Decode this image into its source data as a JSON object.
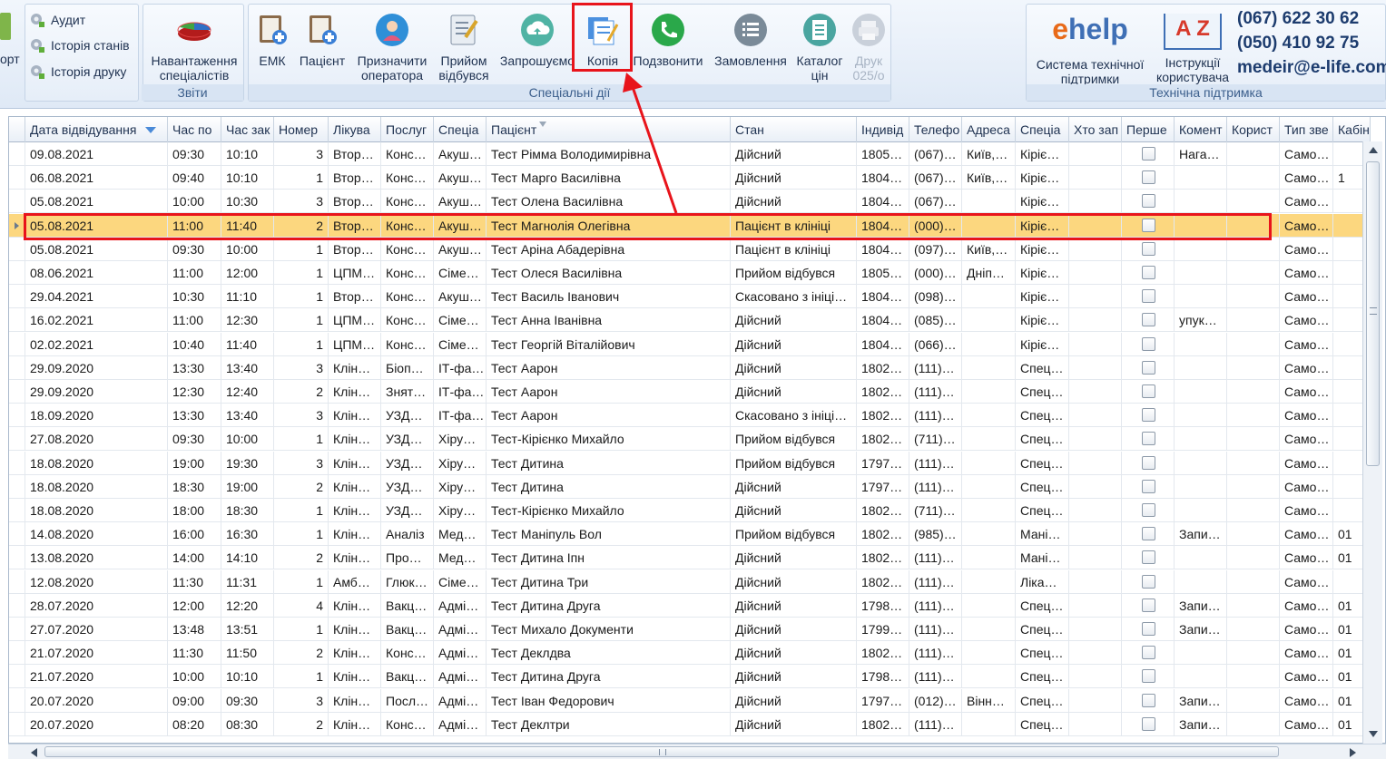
{
  "ribbon": {
    "left_partial_label": "орт",
    "reports_group": {
      "label": "Звіти",
      "items": [
        "Аудит",
        "Історія станів",
        "Історія друку"
      ],
      "workload": "Навантаження\nспеціалістів"
    },
    "special_group": {
      "label": "Спеціальні дії",
      "buttons": [
        {
          "label": "ЕМК"
        },
        {
          "label": "Пацієнт"
        },
        {
          "label": "Призначити\nоператора"
        },
        {
          "label": "Прийом\nвідбувся"
        },
        {
          "label": "Запрошуємо"
        },
        {
          "label": "Копія"
        },
        {
          "label": "Подзвонити"
        },
        {
          "label": "Замовлення"
        },
        {
          "label": "Каталог\nцін"
        },
        {
          "label": "Друк\n025/о"
        }
      ]
    },
    "support_group": {
      "label": "Технічна підтримка",
      "help_logo": "help",
      "help_label": "Система технічної\nпідтримки",
      "manual_label": "Інструкції\nкористувача",
      "az": "A Z",
      "phone1": "(067) 622 30 62",
      "phone2": "(050) 410 92 75",
      "email": "medeir@e-life.com"
    }
  },
  "grid": {
    "columns": [
      "Дата відвідування",
      "Час по",
      "Час зак",
      "Номер",
      "Лікува",
      "Послуг",
      "Спеціа",
      "Пацієнт",
      "Стан",
      "Індивід",
      "Телефо",
      "Адреса",
      "Спеціа",
      "Хто зап",
      "Перше",
      "Комент",
      "Корист",
      "Тип зве",
      "Кабін"
    ],
    "rows": [
      [
        "09.08.2021",
        "09:30",
        "10:10",
        "3",
        "Втор…",
        "Конс…",
        "Акуш…",
        "Тест Рімма Володимирівна",
        "Дійсний",
        "1805…",
        "(067)…",
        "Київ,…",
        "Кіріє…",
        "",
        "",
        "Нага…",
        "",
        "Само…",
        ""
      ],
      [
        "06.08.2021",
        "09:40",
        "10:10",
        "1",
        "Втор…",
        "Конс…",
        "Акуш…",
        "Тест Марго Василівна",
        "Дійсний",
        "1804…",
        "(067)…",
        "Київ,…",
        "Кіріє…",
        "",
        "",
        "",
        "",
        "Само…",
        "1"
      ],
      [
        "05.08.2021",
        "10:00",
        "10:30",
        "3",
        "Втор…",
        "Конс…",
        "Акуш…",
        "Тест Олена Василівна",
        "Дійсний",
        "1804…",
        "(067)…",
        "",
        "Кіріє…",
        "",
        "",
        "",
        "",
        "Само…",
        ""
      ],
      [
        "05.08.2021",
        "11:00",
        "11:40",
        "2",
        "Втор…",
        "Конс…",
        "Акуш…",
        "Тест Магнолія Олегівна",
        "Пацієнт в клініці",
        "1804…",
        "(000)…",
        "",
        "Кіріє…",
        "",
        "",
        "",
        "",
        "Само…",
        ""
      ],
      [
        "05.08.2021",
        "09:30",
        "10:00",
        "1",
        "Втор…",
        "Конс…",
        "Акуш…",
        "Тест Аріна Абадерівна",
        "Пацієнт в клініці",
        "1804…",
        "(097)…",
        "Київ,…",
        "Кіріє…",
        "",
        "",
        "",
        "",
        "Само…",
        ""
      ],
      [
        "08.06.2021",
        "11:00",
        "12:00",
        "1",
        "ЦПМ…",
        "Конс…",
        "Сіме…",
        "Тест Олеся Василівна",
        "Прийом відбувся",
        "1805…",
        "(000)…",
        "Дніп…",
        "Кіріє…",
        "",
        "",
        "",
        "",
        "Само…",
        ""
      ],
      [
        "29.04.2021",
        "10:30",
        "11:10",
        "1",
        "Втор…",
        "Конс…",
        "Акуш…",
        "Тест Василь Іванович",
        "Скасовано з ініці…",
        "1804…",
        "(098)…",
        "",
        "Кіріє…",
        "",
        "",
        "",
        "",
        "Само…",
        ""
      ],
      [
        "16.02.2021",
        "11:00",
        "12:30",
        "1",
        "ЦПМ…",
        "Конс…",
        "Сіме…",
        "Тест Анна Іванівна",
        "Дійсний",
        "1804…",
        "(085)…",
        "",
        "Кіріє…",
        "",
        "",
        "упук…",
        "",
        "Само…",
        ""
      ],
      [
        "02.02.2021",
        "10:40",
        "11:40",
        "1",
        "ЦПМ…",
        "Конс…",
        "Сіме…",
        "Тест Георгій Віталійович",
        "Дійсний",
        "1804…",
        "(066)…",
        "",
        "Кіріє…",
        "",
        "",
        "",
        "",
        "Само…",
        ""
      ],
      [
        "29.09.2020",
        "13:30",
        "13:40",
        "3",
        "Клін…",
        "Біоп…",
        "ІТ-фа…",
        "Тест Аарон",
        "Дійсний",
        "1802…",
        "(111)…",
        "",
        "Спец…",
        "",
        "",
        "",
        "",
        "Само…",
        ""
      ],
      [
        "29.09.2020",
        "12:30",
        "12:40",
        "2",
        "Клін…",
        "Знят…",
        "ІТ-фа…",
        "Тест Аарон",
        "Дійсний",
        "1802…",
        "(111)…",
        "",
        "Спец…",
        "",
        "",
        "",
        "",
        "Само…",
        ""
      ],
      [
        "18.09.2020",
        "13:30",
        "13:40",
        "3",
        "Клін…",
        "УЗД…",
        "ІТ-фа…",
        "Тест Аарон",
        "Скасовано з ініці…",
        "1802…",
        "(111)…",
        "",
        "Спец…",
        "",
        "",
        "",
        "",
        "Само…",
        ""
      ],
      [
        "27.08.2020",
        "09:30",
        "10:00",
        "1",
        "Клін…",
        "УЗД…",
        "Хіру…",
        "Тест-Кірієнко Михайло",
        "Прийом відбувся",
        "1802…",
        "(711)…",
        "",
        "Спец…",
        "",
        "",
        "",
        "",
        "Само…",
        ""
      ],
      [
        "18.08.2020",
        "19:00",
        "19:30",
        "3",
        "Клін…",
        "УЗД…",
        "Хіру…",
        "Тест Дитина",
        "Прийом відбувся",
        "1797…",
        "(111)…",
        "",
        "Спец…",
        "",
        "",
        "",
        "",
        "Само…",
        ""
      ],
      [
        "18.08.2020",
        "18:30",
        "19:00",
        "2",
        "Клін…",
        "УЗД…",
        "Хіру…",
        "Тест Дитина",
        "Дійсний",
        "1797…",
        "(111)…",
        "",
        "Спец…",
        "",
        "",
        "",
        "",
        "Само…",
        ""
      ],
      [
        "18.08.2020",
        "18:00",
        "18:30",
        "1",
        "Клін…",
        "УЗД…",
        "Хіру…",
        "Тест-Кірієнко Михайло",
        "Дійсний",
        "1802…",
        "(711)…",
        "",
        "Спец…",
        "",
        "",
        "",
        "",
        "Само…",
        ""
      ],
      [
        "14.08.2020",
        "16:00",
        "16:30",
        "1",
        "Клін…",
        "Аналіз",
        "Мед…",
        "Тест Маніпуль Вол",
        "Прийом відбувся",
        "1802…",
        "(985)…",
        "",
        "Мані…",
        "",
        "",
        "Запи…",
        "",
        "Само…",
        "01"
      ],
      [
        "13.08.2020",
        "14:00",
        "14:10",
        "2",
        "Клін…",
        "Про…",
        "Мед…",
        "Тест Дитина Іпн",
        "Дійсний",
        "1802…",
        "(111)…",
        "",
        "Мані…",
        "",
        "",
        "",
        "",
        "Само…",
        "01"
      ],
      [
        "12.08.2020",
        "11:30",
        "11:31",
        "1",
        "Амб…",
        "Глюк…",
        "Сіме…",
        "Тест Дитина Три",
        "Дійсний",
        "1802…",
        "(111)…",
        "",
        "Ліка…",
        "",
        "",
        "",
        "",
        "Само…",
        ""
      ],
      [
        "28.07.2020",
        "12:00",
        "12:20",
        "4",
        "Клін…",
        "Вакц…",
        "Адмі…",
        "Тест Дитина Друга",
        "Дійсний",
        "1798…",
        "(111)…",
        "",
        "Спец…",
        "",
        "",
        "Запи…",
        "",
        "Само…",
        "01"
      ],
      [
        "27.07.2020",
        "13:48",
        "13:51",
        "1",
        "Клін…",
        "Вакц…",
        "Адмі…",
        "Тест Михало Документи",
        "Дійсний",
        "1799…",
        "(111)…",
        "",
        "Спец…",
        "",
        "",
        "Запи…",
        "",
        "Само…",
        "01"
      ],
      [
        "21.07.2020",
        "11:30",
        "11:50",
        "2",
        "Клін…",
        "Конс…",
        "Адмі…",
        "Тест Деклдва",
        "Дійсний",
        "1802…",
        "(111)…",
        "",
        "Спец…",
        "",
        "",
        "",
        "",
        "Само…",
        "01"
      ],
      [
        "21.07.2020",
        "10:00",
        "10:10",
        "1",
        "Клін…",
        "Вакц…",
        "Адмі…",
        "Тест Дитина Друга",
        "Дійсний",
        "1798…",
        "(111)…",
        "",
        "Спец…",
        "",
        "",
        "",
        "",
        "Само…",
        "01"
      ],
      [
        "20.07.2020",
        "09:00",
        "09:30",
        "3",
        "Клін…",
        "Посл…",
        "Адмі…",
        "Тест Іван Федорович",
        "Дійсний",
        "1797…",
        "(012)…",
        "Вінн…",
        "Спец…",
        "",
        "",
        "Запи…",
        "",
        "Само…",
        "01"
      ],
      [
        "20.07.2020",
        "08:20",
        "08:30",
        "2",
        "Клін…",
        "Конс…",
        "Адмі…",
        "Тест Деклтри",
        "Дійсний",
        "1802…",
        "(111)…",
        "",
        "Спец…",
        "",
        "",
        "Запи…",
        "",
        "Само…",
        "01"
      ]
    ]
  },
  "colors": {
    "selected_row": "#fcd77f",
    "annotation_red": "#e8141b",
    "header_text": "#1e3150"
  }
}
